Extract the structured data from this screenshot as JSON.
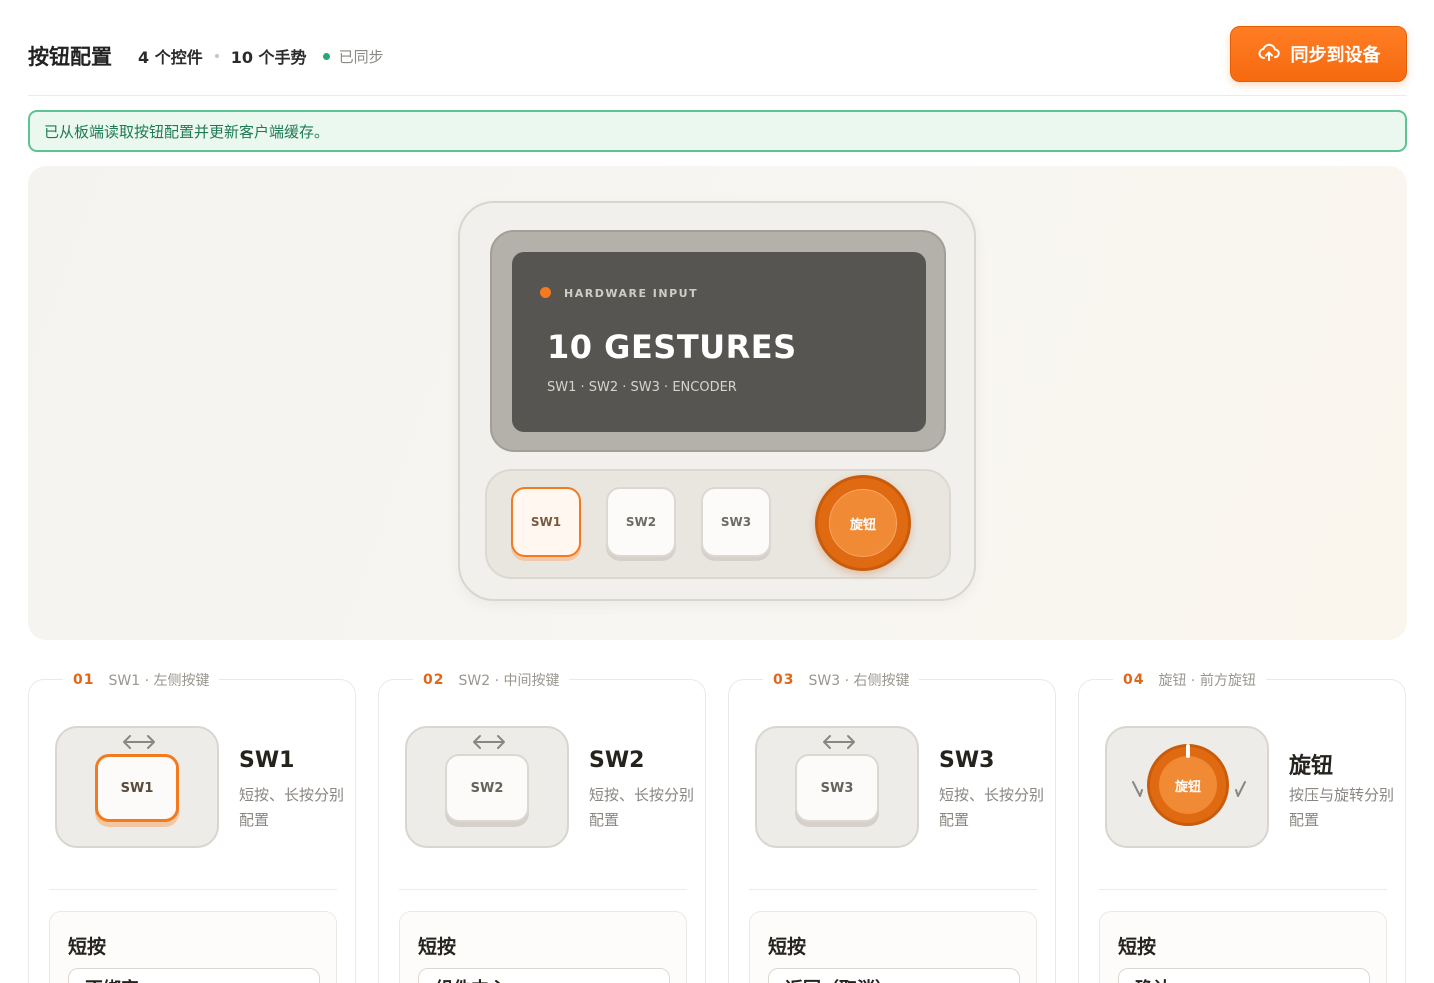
{
  "header": {
    "title": "按钮配置",
    "controls_stat": "4 个控件",
    "gestures_stat": "10 个手势",
    "sync_status": "已同步",
    "sync_button_label": "同步到设备"
  },
  "banner": {
    "message": "已从板端读取按钮配置并更新客户端缓存。"
  },
  "device": {
    "eyebrow": "HARDWARE INPUT",
    "headline": "10 GESTURES",
    "subline": "SW1 · SW2 · SW3 · ENCODER",
    "keys": [
      "SW1",
      "SW2",
      "SW3"
    ],
    "knob_label": "旋钮"
  },
  "cards": [
    {
      "num": "01",
      "name": "SW1 · 左侧按键",
      "key_label": "SW1",
      "title": "SW1",
      "desc": "短按、长按分别配置",
      "gesture": "短按",
      "value": "不绑定"
    },
    {
      "num": "02",
      "name": "SW2 · 中间按键",
      "key_label": "SW2",
      "title": "SW2",
      "desc": "短按、长按分别配置",
      "gesture": "短按",
      "value": "组件中心"
    },
    {
      "num": "03",
      "name": "SW3 · 右侧按键",
      "key_label": "SW3",
      "title": "SW3",
      "desc": "短按、长按分别配置",
      "gesture": "短按",
      "value": "返回（取消）"
    },
    {
      "num": "04",
      "name": "旋钮 · 前方旋钮",
      "key_label": "旋钮",
      "title": "旋钮",
      "desc": "按压与旋转分别配置",
      "gesture": "短按",
      "value": "确认"
    }
  ]
}
